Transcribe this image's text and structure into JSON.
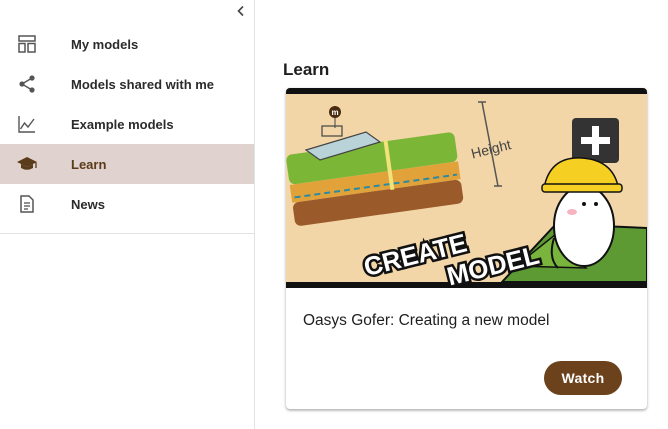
{
  "sidebar": {
    "items": [
      {
        "label": "My models",
        "icon": "dashboard-icon",
        "active": false
      },
      {
        "label": "Models shared with me",
        "icon": "share-icon",
        "active": false
      },
      {
        "label": "Example models",
        "icon": "line-chart-icon",
        "active": false
      },
      {
        "label": "Learn",
        "icon": "graduation-cap-icon",
        "active": true
      },
      {
        "label": "News",
        "icon": "document-icon",
        "active": false
      }
    ],
    "collapse_icon": "chevron-left-icon"
  },
  "main": {
    "title": "Learn",
    "card": {
      "title": "Oasys Gofer: Creating a new model",
      "button_label": "Watch",
      "thumbnail": {
        "dimension_label": "Height",
        "banner_line1": "CREATE",
        "banner_line2": "MODEL",
        "badge_letter": "m"
      }
    }
  },
  "colors": {
    "active_bg": "#e0d2cf",
    "button": "#6b421b",
    "thumb_bg": "#f2d6a8",
    "grass": "#7cb637",
    "soil": "#9a5a2a"
  }
}
